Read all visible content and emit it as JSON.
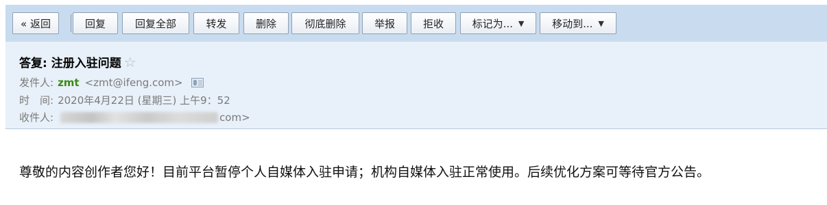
{
  "toolbar": {
    "back": "« 返回",
    "reply": "回复",
    "reply_all": "回复全部",
    "forward": "转发",
    "delete": "删除",
    "delete_permanently": "彻底删除",
    "report": "举报",
    "reject": "拒收",
    "mark_as": "标记为...",
    "move_to": "移动到..."
  },
  "email": {
    "subject": "答复: 注册入驻问题",
    "from_label": "发件人:",
    "from_name": "zmt",
    "from_address": "<zmt@ifeng.com>",
    "time_label": "时　间:",
    "time_value": "2020年4月22日 (星期三) 上午9：52",
    "to_label": "收件人:",
    "to_suffix": "com>",
    "body": "尊敬的内容创作者您好！目前平台暂停个人自媒体入驻申请；机构自媒体入驻正常使用。后续优化方案可等待官方公告。"
  },
  "icons": [
    "star-icon",
    "contact-card-icon",
    "dropdown-arrow-icon"
  ],
  "colors": {
    "toolbar_bg": "#c9dcef",
    "header_bg": "#e8f0f9",
    "sender_name": "#3c8a12"
  }
}
